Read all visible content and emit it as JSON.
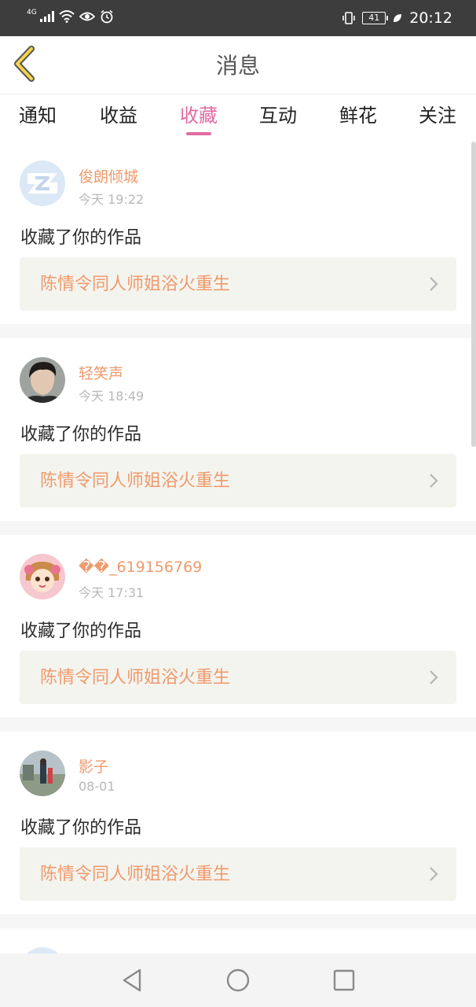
{
  "status_bar": {
    "network": "4G",
    "battery": "41",
    "time": "20:12"
  },
  "header": {
    "title": "消息"
  },
  "tabs": [
    {
      "label": "通知",
      "active": false
    },
    {
      "label": "收益",
      "active": false
    },
    {
      "label": "收藏",
      "active": true
    },
    {
      "label": "互动",
      "active": false
    },
    {
      "label": "鲜花",
      "active": false
    },
    {
      "label": "关注",
      "active": false
    }
  ],
  "messages": [
    {
      "user": "俊朗倾城",
      "time": "今天 19:22",
      "action": "收藏了你的作品",
      "work": "陈情令同人师姐浴火重生"
    },
    {
      "user": "轻笑声",
      "time": "今天 18:49",
      "action": "收藏了你的作品",
      "work": "陈情令同人师姐浴火重生"
    },
    {
      "user": "��_619156769",
      "time": "今天 17:31",
      "action": "收藏了你的作品",
      "work": "陈情令同人师姐浴火重生"
    },
    {
      "user": "影子",
      "time": "08-01",
      "action": "收藏了你的作品",
      "work": "陈情令同人师姐浴火重生"
    }
  ],
  "colors": {
    "accent": "#e26ba0",
    "username": "#ef9a6c",
    "status_bar": "#3d3d3d"
  },
  "icons": [
    "back-chevron-icon",
    "chevron-right-icon",
    "nav-back-icon",
    "nav-home-icon",
    "nav-recents-icon"
  ]
}
